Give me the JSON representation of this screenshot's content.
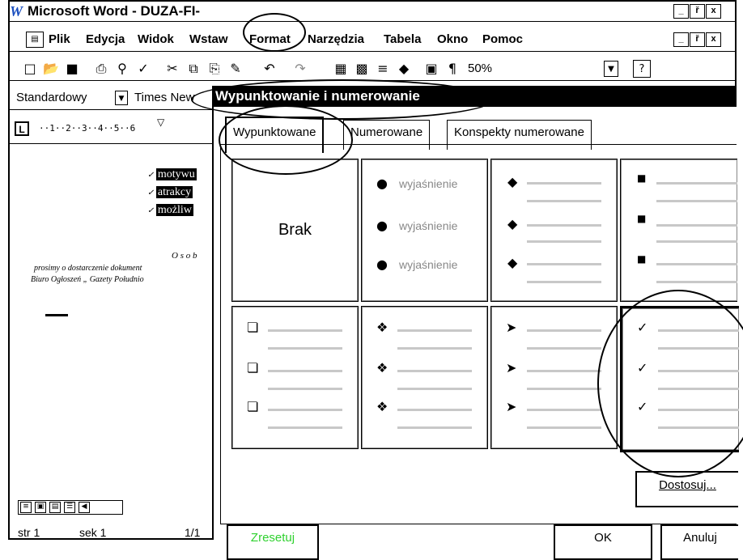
{
  "app": {
    "title": "Microsoft Word - DUZA-FI-",
    "logo": "W",
    "title_buttons": [
      "_",
      "ř",
      "x"
    ]
  },
  "menu": {
    "icon": "word-doc-icon",
    "items": [
      "Plik",
      "Edycja",
      "Widok",
      "Wstaw",
      "Format",
      "Narzędzia",
      "Tabela",
      "Okno",
      "Pomoc"
    ]
  },
  "toolbar": {
    "icons": [
      "new-icon",
      "open-icon",
      "save-icon",
      "print-icon",
      "preview-icon",
      "spell-icon",
      "cut-icon",
      "copy-icon",
      "paste-icon",
      "format-painter-icon",
      "undo-icon",
      "redo-icon",
      "table-icon",
      "excel-icon",
      "columns-icon",
      "drawing-icon",
      "map-icon",
      "paragraph-icon"
    ],
    "zoom": "50%"
  },
  "format_bar": {
    "style": "Standardowy",
    "font": "Times New"
  },
  "ruler": {
    "ticks": "··1··2··3··4··5··6"
  },
  "document": {
    "highlighted": [
      "motywu",
      "atrakcy",
      "możliw"
    ],
    "osoby": "O s o b",
    "line1": "prosimy o dostarczenie dokument",
    "line2": "Biuro Ogłoszeń „ Gazety Południo"
  },
  "status": {
    "page": "str 1",
    "section": "sek 1",
    "pages": "1/1"
  },
  "dialog": {
    "title": "Wypunktowanie i numerowanie",
    "tabs": [
      "Wypunktowane",
      "Numerowane",
      "Konspekty numerowane"
    ],
    "none_label": "Brak",
    "sample_text": "wyjaśnienie",
    "customize_button": "Dostosuj...",
    "reset_button": "Zresetuj",
    "ok_button": "OK",
    "cancel_button": "Anuluj",
    "bullet_styles": [
      "none",
      "dot",
      "diamond",
      "square-small",
      "hollow-square",
      "four-diamond",
      "arrowhead",
      "checkmark"
    ],
    "selected_style": "checkmark"
  }
}
